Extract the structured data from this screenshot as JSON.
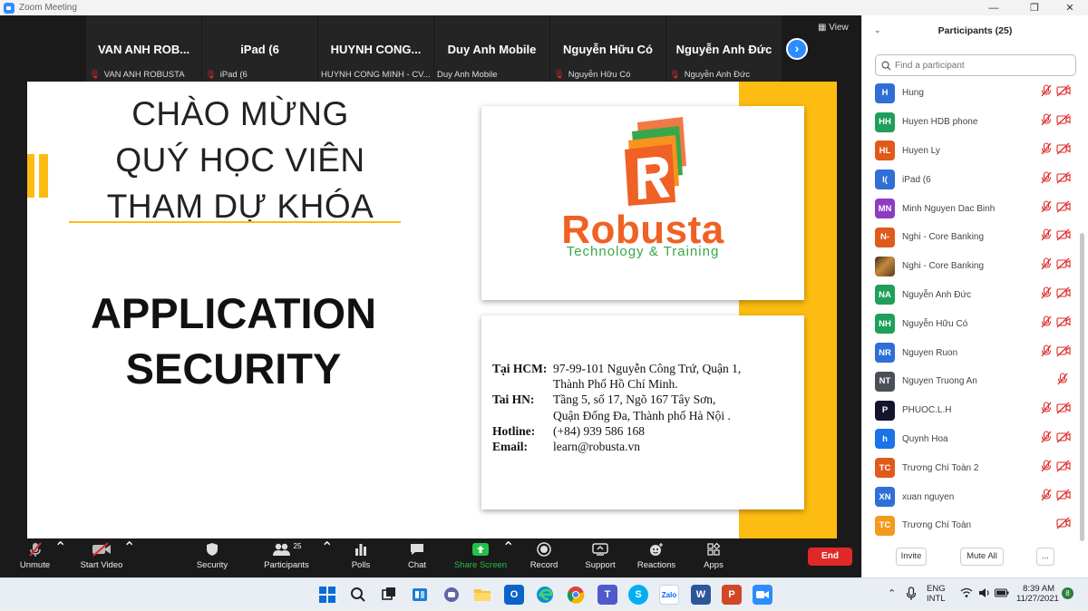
{
  "window": {
    "title": "Zoom Meeting",
    "minimize": "—",
    "maximize": "❐",
    "close": "✕"
  },
  "video_tiles": [
    {
      "name": "VAN ANH ROB...",
      "label": "VAN ANH ROBUSTA"
    },
    {
      "name": "iPad (6",
      "label": "iPad (6"
    },
    {
      "name": "HUYNH CONG...",
      "label": "HUYNH CONG MINH - CV..."
    },
    {
      "name": "Duy Anh Mobile",
      "label": "Duy Anh Mobile"
    },
    {
      "name": "Nguyễn Hữu Có",
      "label": "Nguyễn Hữu Có"
    },
    {
      "name": "Nguyễn Anh Đức",
      "label": "Nguyễn Anh Đức"
    }
  ],
  "view_label": "View",
  "slide": {
    "welcome_lines": [
      "CHÀO MỪNG",
      "QUÝ HỌC VIÊN",
      "THAM DỰ KHÓA"
    ],
    "course_lines": [
      "APPLICATION",
      "SECURITY"
    ],
    "brand_name": "Robusta",
    "brand_tagline": "Technology & Training",
    "contact": {
      "hcm_label": "Tại HCM:",
      "hcm_line1": "97-99-101 Nguyễn Công Trứ, Quận 1,",
      "hcm_line2": "Thành Phố Hồ Chí Minh.",
      "hn_label": "Tai HN:",
      "hn_line1": "Tầng 5, số 17, Ngõ 167 Tây Sơn,",
      "hn_line2": "Quận Đống Đa, Thành phố Hà Nội .",
      "hotline_label": "Hotline:",
      "hotline": "(+84) 939 586 168",
      "email_label": "Email:",
      "email": "learn@robusta.vn"
    },
    "colors": {
      "accent_yellow": "#fdbc11",
      "brand_orange": "#ef6124",
      "brand_green": "#37a84a"
    }
  },
  "toolbar": {
    "unmute": "Unmute",
    "start_video": "Start Video",
    "security": "Security",
    "participants": "Participants",
    "participants_count": "25",
    "polls": "Polls",
    "chat": "Chat",
    "share_screen": "Share Screen",
    "record": "Record",
    "support": "Support",
    "reactions": "Reactions",
    "apps": "Apps",
    "end": "End"
  },
  "panel": {
    "title": "Participants (25)",
    "search_placeholder": "Find a participant",
    "participants": [
      {
        "initials": "H",
        "name": "Hung",
        "color": "#2f6fd6",
        "video_off": true
      },
      {
        "initials": "HH",
        "name": "Huyen HDB phone",
        "color": "#1fa05a",
        "video_off": true
      },
      {
        "initials": "HL",
        "name": "Huyen Ly",
        "color": "#e05a1c",
        "video_off": true
      },
      {
        "initials": "I(",
        "name": "iPad (6",
        "color": "#2f6fd6",
        "video_off": true
      },
      {
        "initials": "MN",
        "name": "Minh Nguyen Dac Binh",
        "color": "#8e3bc4",
        "video_off": true
      },
      {
        "initials": "N-",
        "name": "Nghi - Core Banking",
        "color": "#e05a1c",
        "video_off": true
      },
      {
        "initials": "",
        "name": "Nghi - Core Banking",
        "color": "#6b4a2a",
        "video_off": true,
        "photo": true
      },
      {
        "initials": "NA",
        "name": "Nguyễn Anh Đức",
        "color": "#1fa05a",
        "video_off": true
      },
      {
        "initials": "NH",
        "name": "Nguyễn Hữu Có",
        "color": "#1fa05a",
        "video_off": true
      },
      {
        "initials": "NR",
        "name": "Nguyen Ruon",
        "color": "#2f6fd6",
        "video_off": true
      },
      {
        "initials": "NT",
        "name": "Nguyen Truong An",
        "color": "#4a4f58",
        "video_off": false
      },
      {
        "initials": "P",
        "name": "PHUOC.L.H",
        "color": "#14142e",
        "video_off": true,
        "photo": true
      },
      {
        "initials": "h",
        "name": "Quynh Hoa",
        "color": "#1a73e8",
        "video_off": true
      },
      {
        "initials": "TC",
        "name": "Trương Chí Toàn 2",
        "color": "#e05a1c",
        "video_off": true
      },
      {
        "initials": "XN",
        "name": "xuan nguyen",
        "color": "#2f6fd6",
        "video_off": true
      },
      {
        "initials": "TC",
        "name": "Trương Chí Toàn",
        "color": "#f29b1d",
        "video_off": true,
        "mic_hidden": true
      }
    ],
    "invite": "Invite",
    "mute_all": "Mute All",
    "more": "..."
  },
  "taskbar": {
    "lang_line1": "ENG",
    "lang_line2": "INTL",
    "time": "8:39 AM",
    "date": "11/27/2021",
    "notification_count": "8"
  }
}
